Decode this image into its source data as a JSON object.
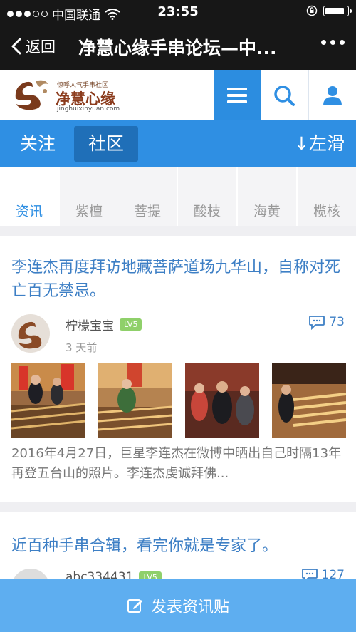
{
  "status": {
    "carrier": "中国联通",
    "time": "23:55",
    "battery_level": 0.85
  },
  "nav": {
    "back_label": "返回",
    "title": "净慧心缘手串论坛—中..."
  },
  "site": {
    "logo_tagline": "惊呼人气手串社区",
    "logo_name": "净慧心缘",
    "logo_url": "jinghuixinyuan.com"
  },
  "tabs": {
    "follow": "关注",
    "community": "社区",
    "swipe_hint": "↓左滑"
  },
  "categories": [
    "资讯",
    "紫檀",
    "菩提",
    "酸枝",
    "海黄",
    "榄核"
  ],
  "posts": [
    {
      "title": "李连杰再度拜访地藏菩萨道场九华山，自称对死亡百无禁忌。",
      "author": "柠檬宝宝",
      "level": "LV5",
      "time": "3 天前",
      "comments": "73",
      "excerpt": "2016年4月27日，巨星李连杰在微博中晒出自己时隔13年再登五台山的照片。李连杰虔诚拜佛..."
    },
    {
      "title": "近百种手串合辑，看完你就是专家了。",
      "author": "abc334431",
      "level": "LV5",
      "comments": "127"
    }
  ],
  "post_button": {
    "label": "发表资讯贴"
  },
  "colors": {
    "accent": "#2f8fe3",
    "title_link": "#3d7fc5",
    "level_badge": "#8fd06a"
  }
}
